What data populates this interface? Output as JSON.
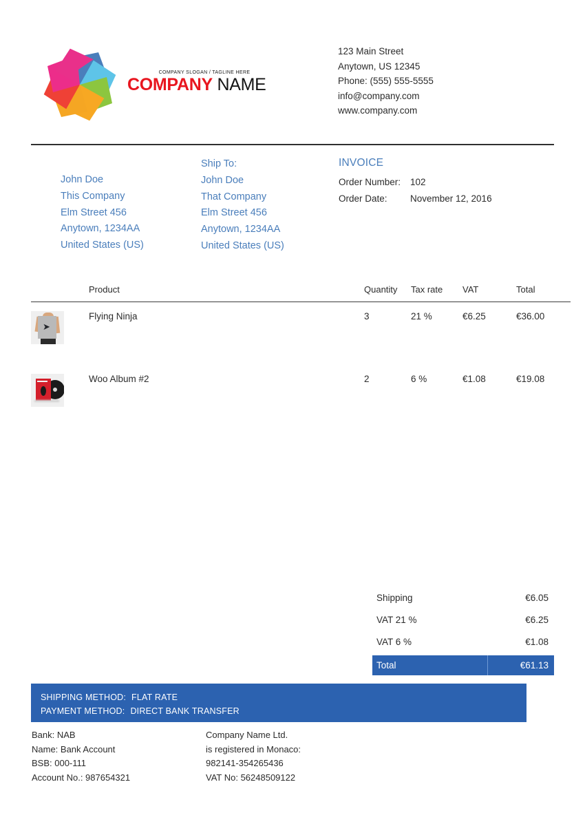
{
  "brand": {
    "slogan": "COMPANY SLOGAN / TAGLINE HERE",
    "name_part1": "COMPANY",
    "name_part2": " NAME",
    "logo_icon": "pinwheel-logo",
    "accent_red": "#e8161f",
    "accent_blue": "#2c62b0",
    "link_blue": "#4a7ebb"
  },
  "company_address": {
    "street": "123 Main Street",
    "city": "Anytown, US 12345",
    "phone": "Phone: (555) 555-5555",
    "email": "info@company.com",
    "website": "www.company.com"
  },
  "billing": {
    "name": "John Doe",
    "company": "This Company",
    "street": "Elm Street 456",
    "city": "Anytown, 1234AA",
    "country": "United States (US)"
  },
  "shipping": {
    "heading": "Ship To:",
    "name": "John Doe",
    "company": "That Company",
    "street": "Elm Street 456",
    "city": "Anytown, 1234AA",
    "country": "United States (US)"
  },
  "invoice": {
    "title": "INVOICE",
    "order_number_label": "Order Number:",
    "order_number": "102",
    "order_date_label": "Order Date:",
    "order_date": "November 12, 2016"
  },
  "table": {
    "headers": {
      "product": "Product",
      "quantity": "Quantity",
      "tax_rate": "Tax rate",
      "vat": "VAT",
      "total": "Total"
    },
    "rows": [
      {
        "thumb": "tshirt-thumbnail",
        "product": "Flying Ninja",
        "quantity": "3",
        "tax_rate": "21 %",
        "vat": "€6.25",
        "total": "€36.00"
      },
      {
        "thumb": "album-thumbnail",
        "product": "Woo Album #2",
        "quantity": "2",
        "tax_rate": "6 %",
        "vat": "€1.08",
        "total": "€19.08"
      }
    ]
  },
  "totals": [
    {
      "label": "Shipping",
      "value": "€6.05"
    },
    {
      "label": "VAT 21 %",
      "value": "€6.25"
    },
    {
      "label": "VAT 6 %",
      "value": "€1.08"
    }
  ],
  "grand_total": {
    "label": "Total",
    "value": "€61.13"
  },
  "methods": {
    "shipping_label": "SHIPPING METHOD:",
    "shipping_value": "FLAT RATE",
    "payment_label": "PAYMENT METHOD:",
    "payment_value": "DIRECT BANK TRANSFER"
  },
  "footer": {
    "left": [
      "Bank: NAB",
      "Name: Bank Account",
      "BSB: 000-111",
      "Account No.: 987654321"
    ],
    "right": [
      "Company Name Ltd.",
      "is registered in Monaco:",
      "982141-354265436",
      "VAT No: 56248509122"
    ]
  }
}
